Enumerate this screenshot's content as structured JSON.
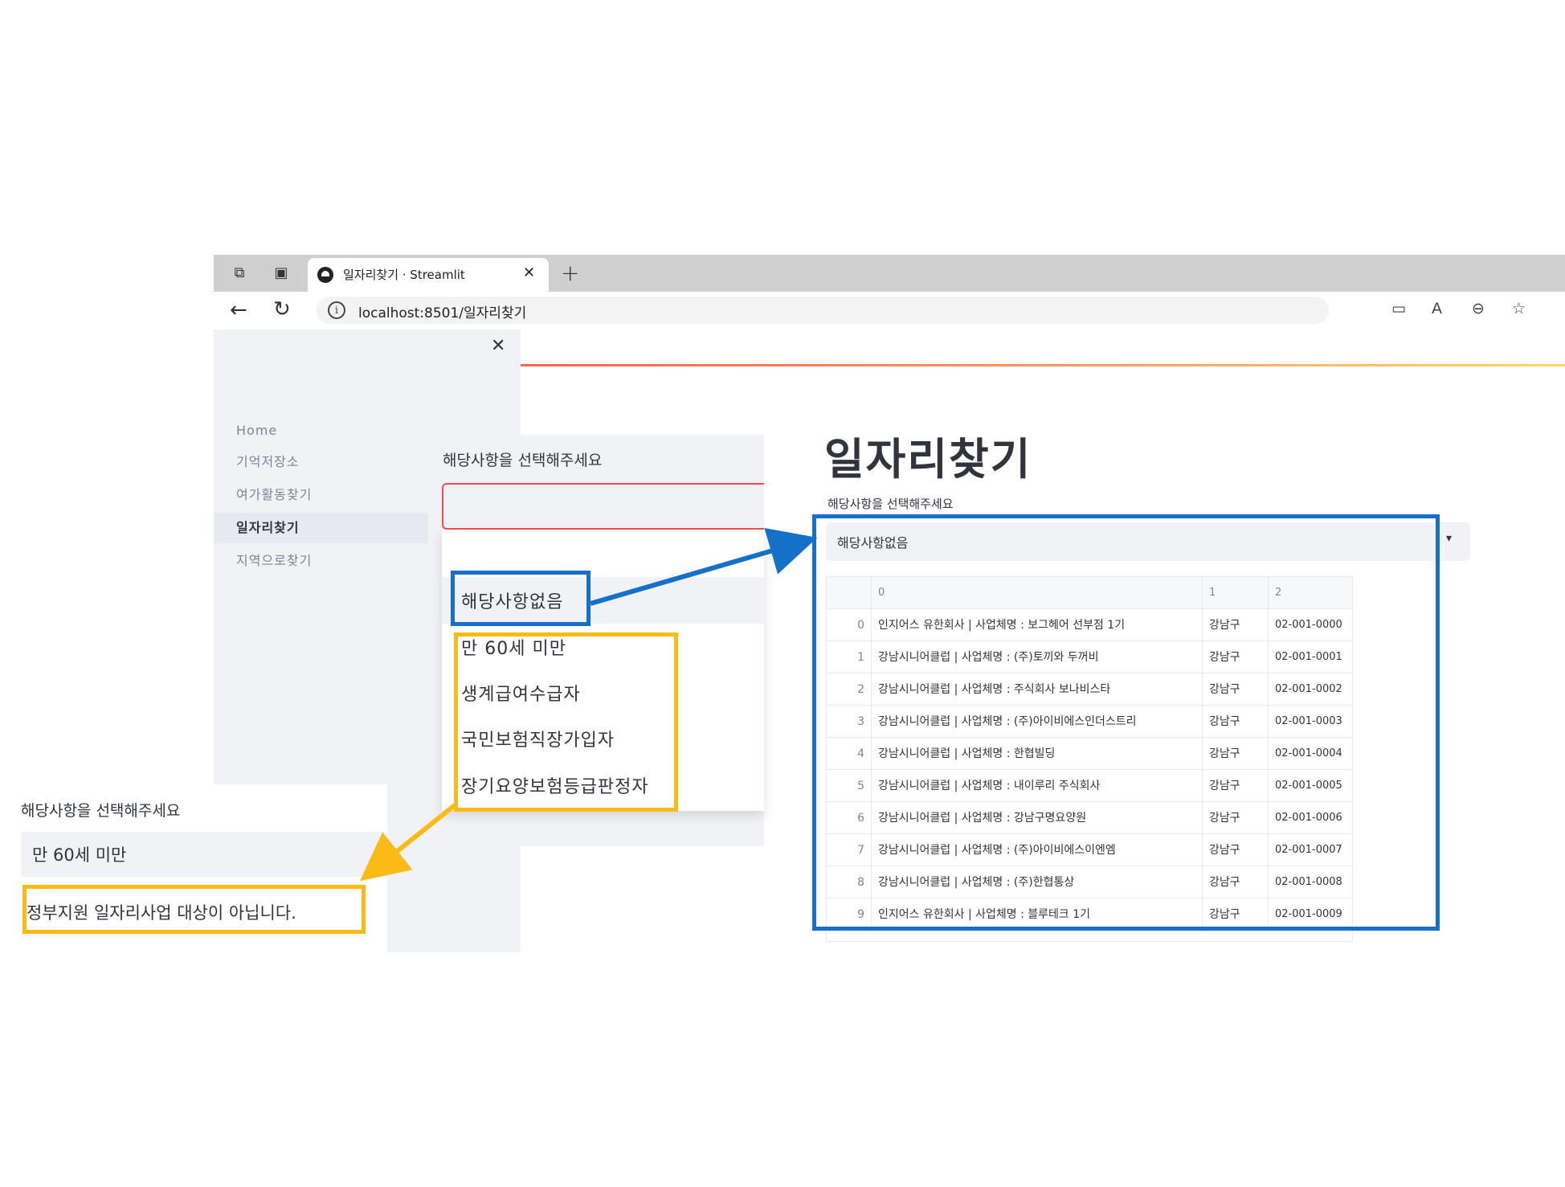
{
  "colors": {
    "blue_annotation": "#1570c9",
    "yellow_annotation": "#fbbb16",
    "streamlit_red": "#ff4b4b",
    "sidebar_bg": "#f0f2f6"
  },
  "browser": {
    "tab_title": "일자리찾기 · Streamlit",
    "url": "localhost:8501/일자리찾기",
    "icons": [
      "workspaces-icon",
      "tab-actions-icon",
      "streamlit-favicon",
      "close-icon",
      "new-tab-icon",
      "back-icon",
      "reload-icon",
      "info-icon",
      "camera-icon",
      "read-aloud-icon",
      "zoom-out-icon",
      "favorite-star-icon"
    ]
  },
  "sidebar": {
    "items": [
      {
        "label": "Home",
        "active": false
      },
      {
        "label": "기억저장소",
        "active": false
      },
      {
        "label": "여가활동찾기",
        "active": false
      },
      {
        "label": "일자리찾기",
        "active": true
      },
      {
        "label": "지역으로찾기",
        "active": false
      }
    ]
  },
  "main": {
    "title": "일자리찾기",
    "select_label": "해당사항을 선택해주세요",
    "select_value": "해당사항없음",
    "table": {
      "columns": [
        "0",
        "1",
        "2"
      ],
      "rows": [
        {
          "idx": "0",
          "c0": "인지어스 유한회사 | 사업체명 : 보그헤어 선부점 1기",
          "c1": "강남구",
          "c2": "02-001-0000"
        },
        {
          "idx": "1",
          "c0": "강남시니어클럽 | 사업체명 : (주)토끼와 두꺼비",
          "c1": "강남구",
          "c2": "02-001-0001"
        },
        {
          "idx": "2",
          "c0": "강남시니어클럽 | 사업체명 : 주식회사 보나비스타",
          "c1": "강남구",
          "c2": "02-001-0002"
        },
        {
          "idx": "3",
          "c0": "강남시니어클럽 | 사업체명 : (주)아이비에스인더스트리",
          "c1": "강남구",
          "c2": "02-001-0003"
        },
        {
          "idx": "4",
          "c0": "강남시니어클럽 | 사업체명 : 한협빌딩",
          "c1": "강남구",
          "c2": "02-001-0004"
        },
        {
          "idx": "5",
          "c0": "강남시니어클럽 | 사업체명 : 내이루리 주식회사",
          "c1": "강남구",
          "c2": "02-001-0005"
        },
        {
          "idx": "6",
          "c0": "강남시니어클럽 | 사업체명 : 강남구명요양원",
          "c1": "강남구",
          "c2": "02-001-0006"
        },
        {
          "idx": "7",
          "c0": "강남시니어클럽 | 사업체명 : (주)아이비에스이엔엠",
          "c1": "강남구",
          "c2": "02-001-0007"
        },
        {
          "idx": "8",
          "c0": "강남시니어클럽 | 사업체명 : (주)한협통상",
          "c1": "강남구",
          "c2": "02-001-0008"
        },
        {
          "idx": "9",
          "c0": "인지어스 유한회사 | 사업체명 : 블루테크 1기",
          "c1": "강남구",
          "c2": "02-001-0009"
        }
      ]
    }
  },
  "dropdown_overlay": {
    "label": "해당사항을 선택해주세요",
    "options": [
      "해당사항없음",
      "만 60세 미만",
      "생계급여수급자",
      "국민보험직장가입자",
      "장기요양보험등급판정자"
    ]
  },
  "result_overlay": {
    "label": "해당사항을 선택해주세요",
    "selected": "만 60세 미만",
    "message": "정부지원 일자리사업 대상이 아닙니다."
  }
}
